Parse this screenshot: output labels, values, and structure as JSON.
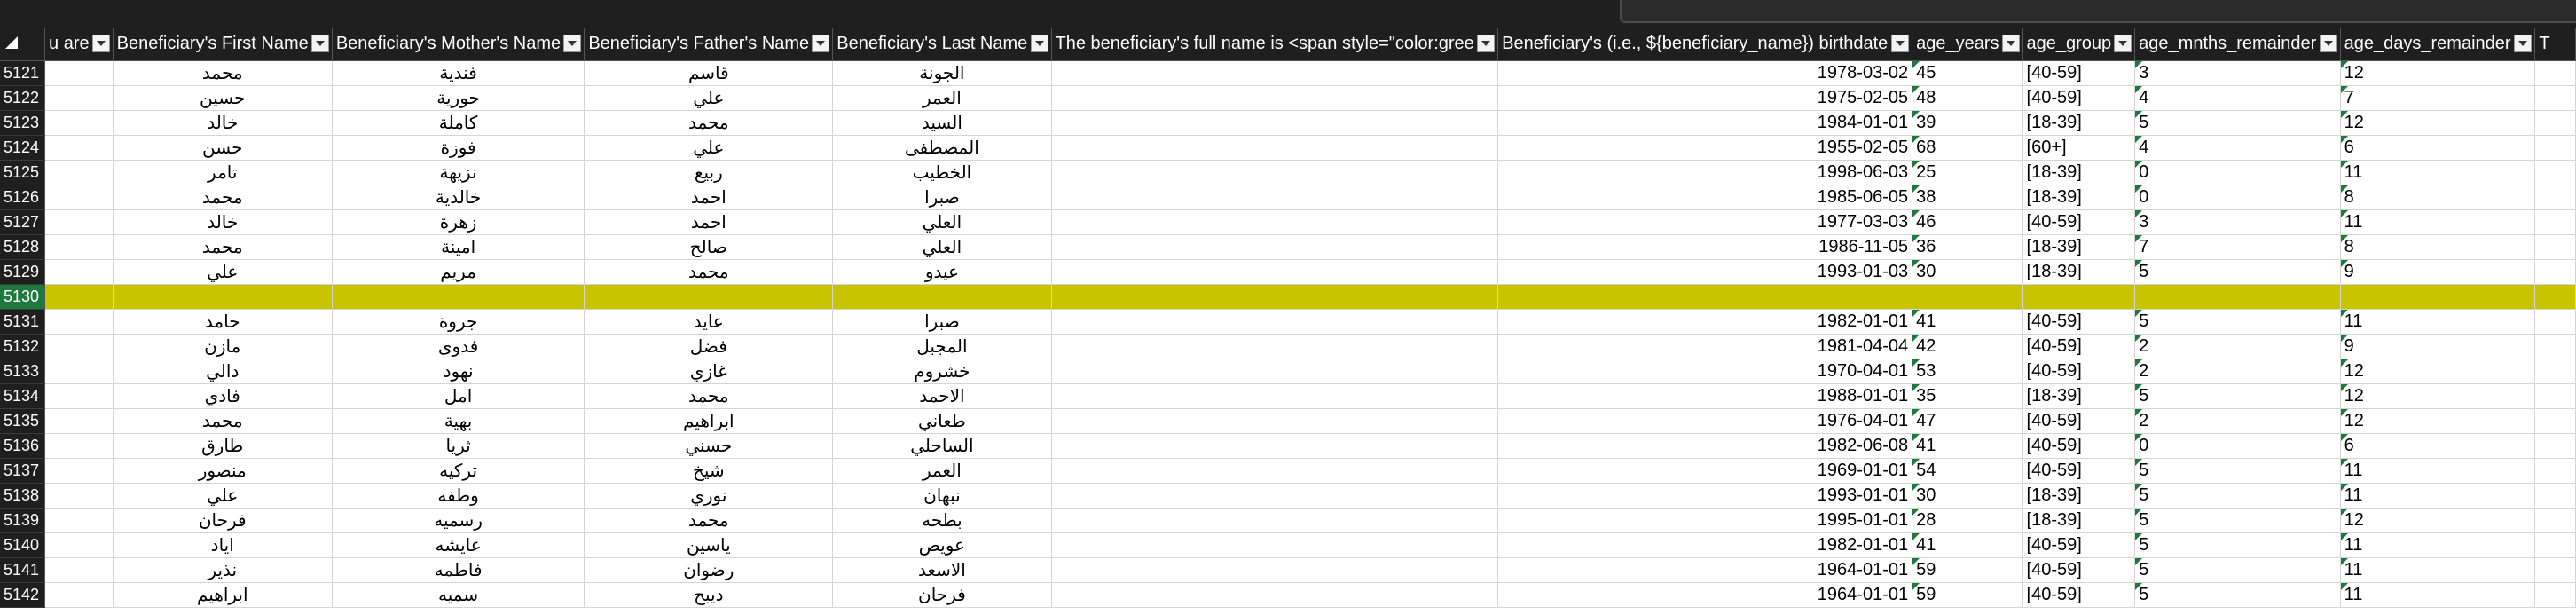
{
  "columns": [
    {
      "key": "prev",
      "label": "u are"
    },
    {
      "key": "first",
      "label": "Beneficiary's First Name"
    },
    {
      "key": "mother",
      "label": "Beneficiary's Mother's Name"
    },
    {
      "key": "father",
      "label": "Beneficiary's Father's Name"
    },
    {
      "key": "last",
      "label": "Beneficiary's Last Name"
    },
    {
      "key": "full",
      "label": "The beneficiary's full name is <span style=\"color:gree"
    },
    {
      "key": "bdate_label",
      "label": "Beneficiary's (i.e., ${beneficiary_name}) birthdate"
    },
    {
      "key": "age_years",
      "label": "age_years"
    },
    {
      "key": "age_group",
      "label": "age_group"
    },
    {
      "key": "age_months",
      "label": "age_mnths_remainder"
    },
    {
      "key": "age_days",
      "label": "age_days_remainder"
    },
    {
      "key": "next",
      "label": "T"
    }
  ],
  "rows": [
    {
      "num": "5121",
      "first": "محمد",
      "mother": "فندية",
      "father": "قاسم",
      "last": "الجونة",
      "birthdate": "1978-03-02",
      "age_years": "45",
      "age_group": "[40-59]",
      "months": "3",
      "days": "12"
    },
    {
      "num": "5122",
      "first": "حسين",
      "mother": "حورية",
      "father": "علي",
      "last": "العمر",
      "birthdate": "1975-02-05",
      "age_years": "48",
      "age_group": "[40-59]",
      "months": "4",
      "days": "7"
    },
    {
      "num": "5123",
      "first": "خالد",
      "mother": "كاملة",
      "father": "محمد",
      "last": "السيد",
      "birthdate": "1984-01-01",
      "age_years": "39",
      "age_group": "[18-39]",
      "months": "5",
      "days": "12"
    },
    {
      "num": "5124",
      "first": "حسن",
      "mother": "فوزة",
      "father": "علي",
      "last": "المصطفى",
      "birthdate": "1955-02-05",
      "age_years": "68",
      "age_group": "[60+]",
      "months": "4",
      "days": "6"
    },
    {
      "num": "5125",
      "first": "تامر",
      "mother": "نزيهة",
      "father": "ربيع",
      "last": "الخطيب",
      "birthdate": "1998-06-03",
      "age_years": "25",
      "age_group": "[18-39]",
      "months": "0",
      "days": "11"
    },
    {
      "num": "5126",
      "first": "محمد",
      "mother": "خالدية",
      "father": "احمد",
      "last": "صبرا",
      "birthdate": "1985-06-05",
      "age_years": "38",
      "age_group": "[18-39]",
      "months": "0",
      "days": "8"
    },
    {
      "num": "5127",
      "first": "خالد",
      "mother": "زهرة",
      "father": "احمد",
      "last": "العلي",
      "birthdate": "1977-03-03",
      "age_years": "46",
      "age_group": "[40-59]",
      "months": "3",
      "days": "11"
    },
    {
      "num": "5128",
      "first": "محمد",
      "mother": "امينة",
      "father": "صالح",
      "last": "العلي",
      "birthdate": "1986-11-05",
      "age_years": "36",
      "age_group": "[18-39]",
      "months": "7",
      "days": "8"
    },
    {
      "num": "5129",
      "first": "علي",
      "mother": "مريم",
      "father": "محمد",
      "last": "عيدو",
      "birthdate": "1993-01-03",
      "age_years": "30",
      "age_group": "[18-39]",
      "months": "5",
      "days": "9"
    },
    {
      "num": "5130",
      "first": "",
      "mother": "",
      "father": "",
      "last": "",
      "birthdate": "",
      "age_years": "",
      "age_group": "",
      "months": "",
      "days": "",
      "highlight": true
    },
    {
      "num": "5131",
      "first": "حامد",
      "mother": "جروة",
      "father": "عايد",
      "last": "صبرا",
      "birthdate": "1982-01-01",
      "age_years": "41",
      "age_group": "[40-59]",
      "months": "5",
      "days": "11"
    },
    {
      "num": "5132",
      "first": "مازن",
      "mother": "فدوى",
      "father": "فضل",
      "last": "المجبل",
      "birthdate": "1981-04-04",
      "age_years": "42",
      "age_group": "[40-59]",
      "months": "2",
      "days": "9"
    },
    {
      "num": "5133",
      "first": "دالي",
      "mother": "نهود",
      "father": "غازي",
      "last": "خشروم",
      "birthdate": "1970-04-01",
      "age_years": "53",
      "age_group": "[40-59]",
      "months": "2",
      "days": "12"
    },
    {
      "num": "5134",
      "first": "فادي",
      "mother": "امل",
      "father": "محمد",
      "last": "الاحمد",
      "birthdate": "1988-01-01",
      "age_years": "35",
      "age_group": "[18-39]",
      "months": "5",
      "days": "12"
    },
    {
      "num": "5135",
      "first": "محمد",
      "mother": "بهية",
      "father": "ابراهيم",
      "last": "طعاني",
      "birthdate": "1976-04-01",
      "age_years": "47",
      "age_group": "[40-59]",
      "months": "2",
      "days": "12"
    },
    {
      "num": "5136",
      "first": "طارق",
      "mother": "ثريا",
      "father": "حسني",
      "last": "الساحلي",
      "birthdate": "1982-06-08",
      "age_years": "41",
      "age_group": "[40-59]",
      "months": "0",
      "days": "6"
    },
    {
      "num": "5137",
      "first": "منصور",
      "mother": "تركيه",
      "father": "شيخ",
      "last": "العمر",
      "birthdate": "1969-01-01",
      "age_years": "54",
      "age_group": "[40-59]",
      "months": "5",
      "days": "11"
    },
    {
      "num": "5138",
      "first": "علي",
      "mother": "وطفه",
      "father": "نوري",
      "last": "نبهان",
      "birthdate": "1993-01-01",
      "age_years": "30",
      "age_group": "[18-39]",
      "months": "5",
      "days": "11"
    },
    {
      "num": "5139",
      "first": "فرحان",
      "mother": "رسميه",
      "father": "محمد",
      "last": "بطحه",
      "birthdate": "1995-01-01",
      "age_years": "28",
      "age_group": "[18-39]",
      "months": "5",
      "days": "12"
    },
    {
      "num": "5140",
      "first": "اياد",
      "mother": "عايشه",
      "father": "ياسين",
      "last": "عويص",
      "birthdate": "1982-01-01",
      "age_years": "41",
      "age_group": "[40-59]",
      "months": "5",
      "days": "11"
    },
    {
      "num": "5141",
      "first": "نذير",
      "mother": "فاطمه",
      "father": "رضوان",
      "last": "الاسعد",
      "birthdate": "1964-01-01",
      "age_years": "59",
      "age_group": "[40-59]",
      "months": "5",
      "days": "11"
    },
    {
      "num": "5142",
      "first": "ابراهيم",
      "mother": "سميه",
      "father": "ديبح",
      "last": "فرحان",
      "birthdate": "1964-01-01",
      "age_years": "59",
      "age_group": "[40-59]",
      "months": "5",
      "days": "11"
    }
  ],
  "colors": {
    "header_bg": "#1f1f1f",
    "highlight_row": "#c8c400",
    "selected_rownum": "#1e7a3c",
    "gridline": "#d4d4d4"
  }
}
